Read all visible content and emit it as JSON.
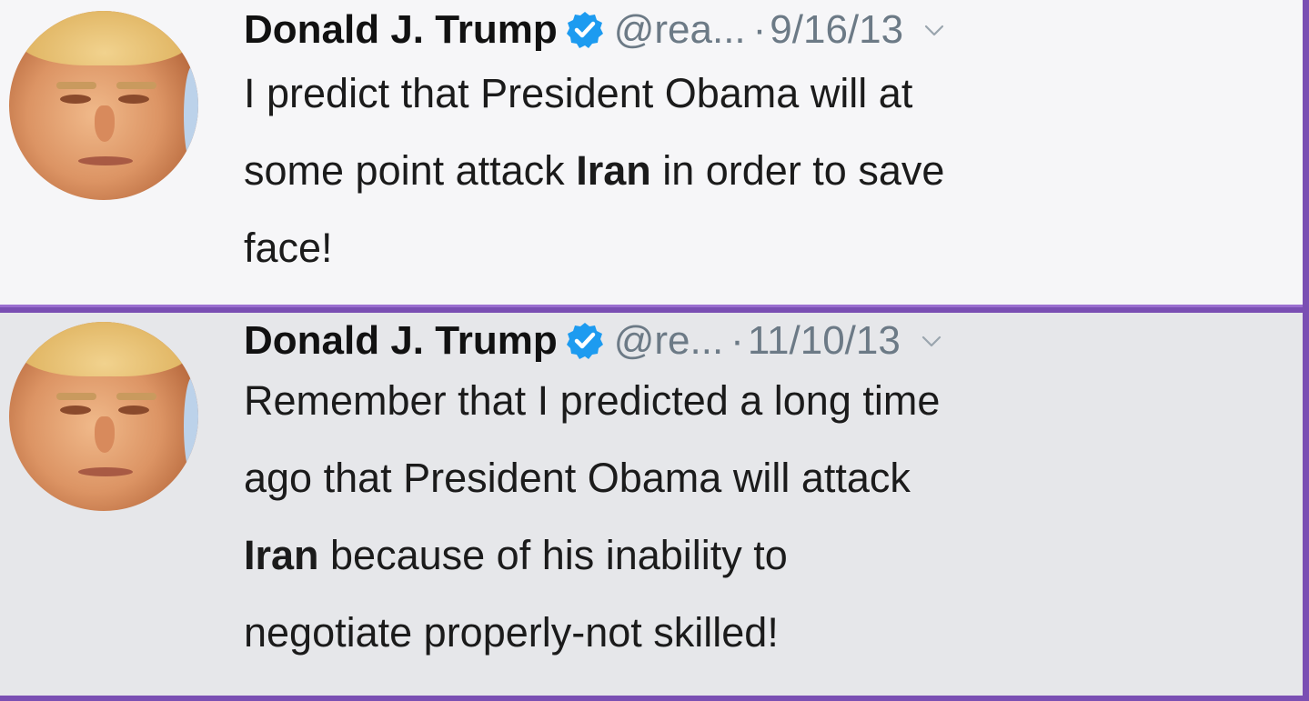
{
  "tweets": [
    {
      "name": "Donald J. Trump",
      "handle": "@rea...",
      "dot": "·",
      "date": "9/16/13",
      "lines": [
        {
          "pre": "I predict that President Obama will at",
          "bold": "",
          "post": ""
        },
        {
          "pre": "some point attack ",
          "bold": "Iran",
          "post": " in order to save"
        },
        {
          "pre": "face!",
          "bold": "",
          "post": ""
        }
      ]
    },
    {
      "name": "Donald J. Trump",
      "handle": "@re...",
      "dot": "·",
      "date": "11/10/13",
      "lines": [
        {
          "pre": "Remember that I predicted a long time",
          "bold": "",
          "post": ""
        },
        {
          "pre": "ago that President Obama will attack",
          "bold": "",
          "post": ""
        },
        {
          "pre": "",
          "bold": "Iran",
          "post": " because of his inability to"
        },
        {
          "pre": "negotiate properly-not skilled!",
          "bold": "",
          "post": ""
        }
      ]
    }
  ],
  "icons": {
    "verified": "verified-badge-icon",
    "menu": "chevron-down-icon"
  },
  "colors": {
    "verified_blue": "#1d9bf0",
    "separator_purple": "#9b6fd0",
    "meta_gray": "#6c7a86"
  }
}
